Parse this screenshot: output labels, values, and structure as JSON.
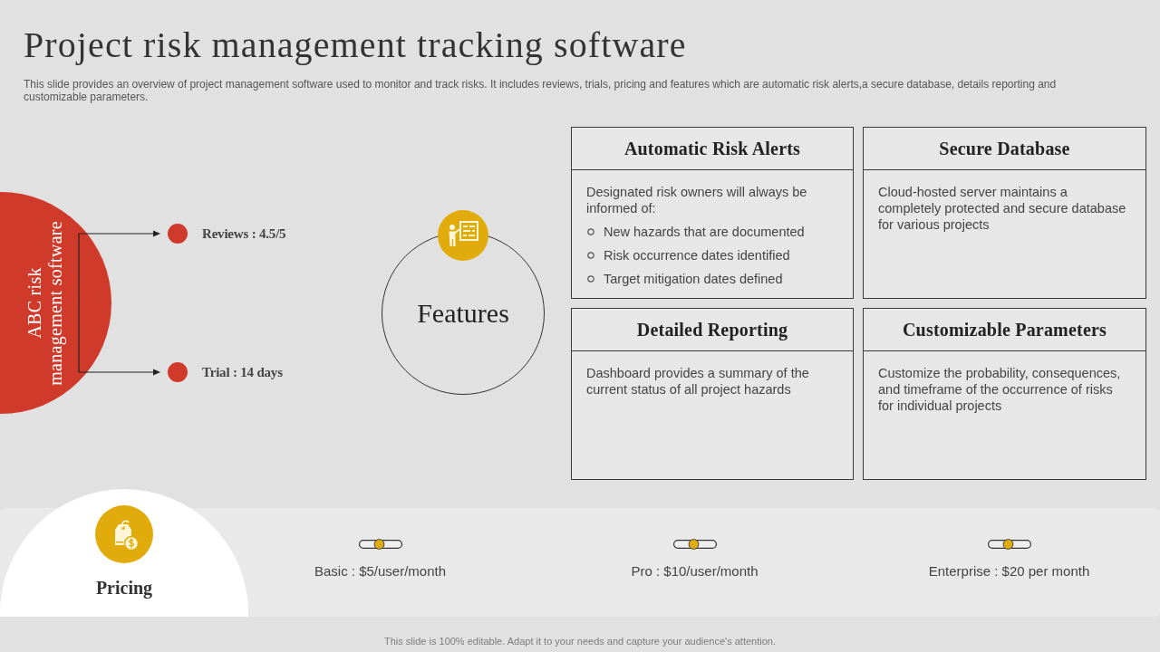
{
  "title": "Project risk management tracking software",
  "description": "This slide provides an overview of project management software used to monitor and track risks. It includes reviews, trials, pricing and features which are automatic risk alerts,a secure database, details reporting and customizable parameters.",
  "product": {
    "lines": [
      "ABC risk",
      "management software"
    ],
    "items": [
      {
        "label": "Reviews : 4.5/5"
      },
      {
        "label": "Trial : 14 days"
      }
    ]
  },
  "features": {
    "label": "Features",
    "cards": [
      {
        "title": "Automatic Risk Alerts",
        "text": "Designated risk owners will always be informed of:",
        "bullets": [
          "New hazards that are documented",
          "Risk occurrence dates identified",
          "Target mitigation dates defined"
        ]
      },
      {
        "title": "Secure Database",
        "text": "Cloud-hosted server maintains a completely protected and secure database for various projects"
      },
      {
        "title": "Detailed Reporting",
        "text": "Dashboard provides a summary of the current status of all project hazards"
      },
      {
        "title": "Customizable Parameters",
        "text": "Customize the probability, consequences, and timeframe of the occurrence of risks for individual projects"
      }
    ]
  },
  "pricing": {
    "label": "Pricing",
    "plans": [
      {
        "label": "Basic : $5/user/month"
      },
      {
        "label": "Pro : $10/user/month"
      },
      {
        "label": "Enterprise : $20 per month"
      }
    ]
  },
  "footer": "This slide is 100% editable. Adapt it to your needs and capture your audience's attention."
}
